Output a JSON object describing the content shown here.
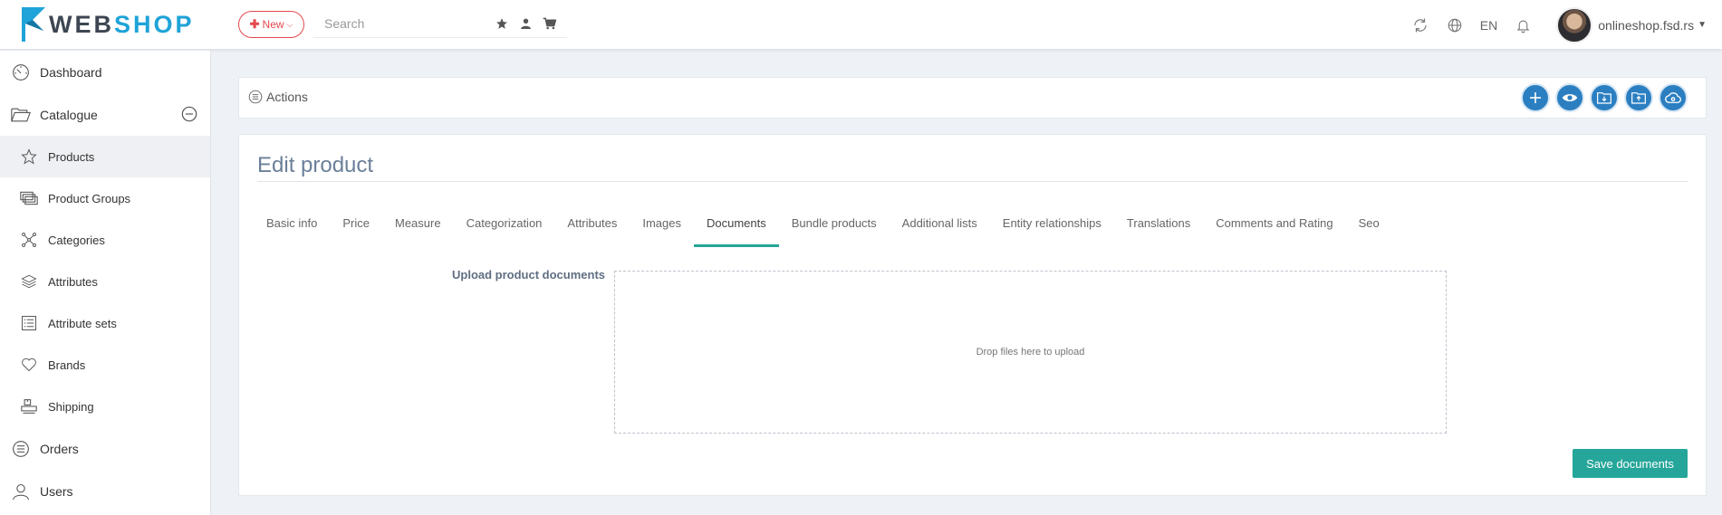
{
  "header": {
    "logo_web": "WEB",
    "logo_shop": "SHOP",
    "new_label": "New",
    "search_placeholder": "Search",
    "language": "EN",
    "account": "onlineshop.fsd.rs"
  },
  "sidebar": {
    "items": [
      {
        "label": "Dashboard",
        "icon": "dashboard-icon"
      },
      {
        "label": "Catalogue",
        "icon": "folder-open-icon"
      },
      {
        "label": "Products",
        "icon": "star-outline-icon"
      },
      {
        "label": "Product Groups",
        "icon": "product-groups-icon"
      },
      {
        "label": "Categories",
        "icon": "categories-icon"
      },
      {
        "label": "Attributes",
        "icon": "layers-icon"
      },
      {
        "label": "Attribute sets",
        "icon": "list-icon"
      },
      {
        "label": "Brands",
        "icon": "heart-icon"
      },
      {
        "label": "Shipping",
        "icon": "shipping-icon"
      },
      {
        "label": "Orders",
        "icon": "orders-icon"
      },
      {
        "label": "Users",
        "icon": "users-icon"
      }
    ]
  },
  "actions": {
    "label": "Actions"
  },
  "main": {
    "title": "Edit product",
    "tabs": [
      "Basic info",
      "Price",
      "Measure",
      "Categorization",
      "Attributes",
      "Images",
      "Documents",
      "Bundle products",
      "Additional lists",
      "Entity relationships",
      "Translations",
      "Comments and Rating",
      "Seo"
    ],
    "active_tab": "Documents",
    "upload_label": "Upload product documents",
    "dropzone_text": "Drop files here to upload",
    "save_label": "Save documents"
  },
  "colors": {
    "accent_green": "#26a69a",
    "accent_blue": "#2b7fc1",
    "new_red": "#e5484d"
  }
}
